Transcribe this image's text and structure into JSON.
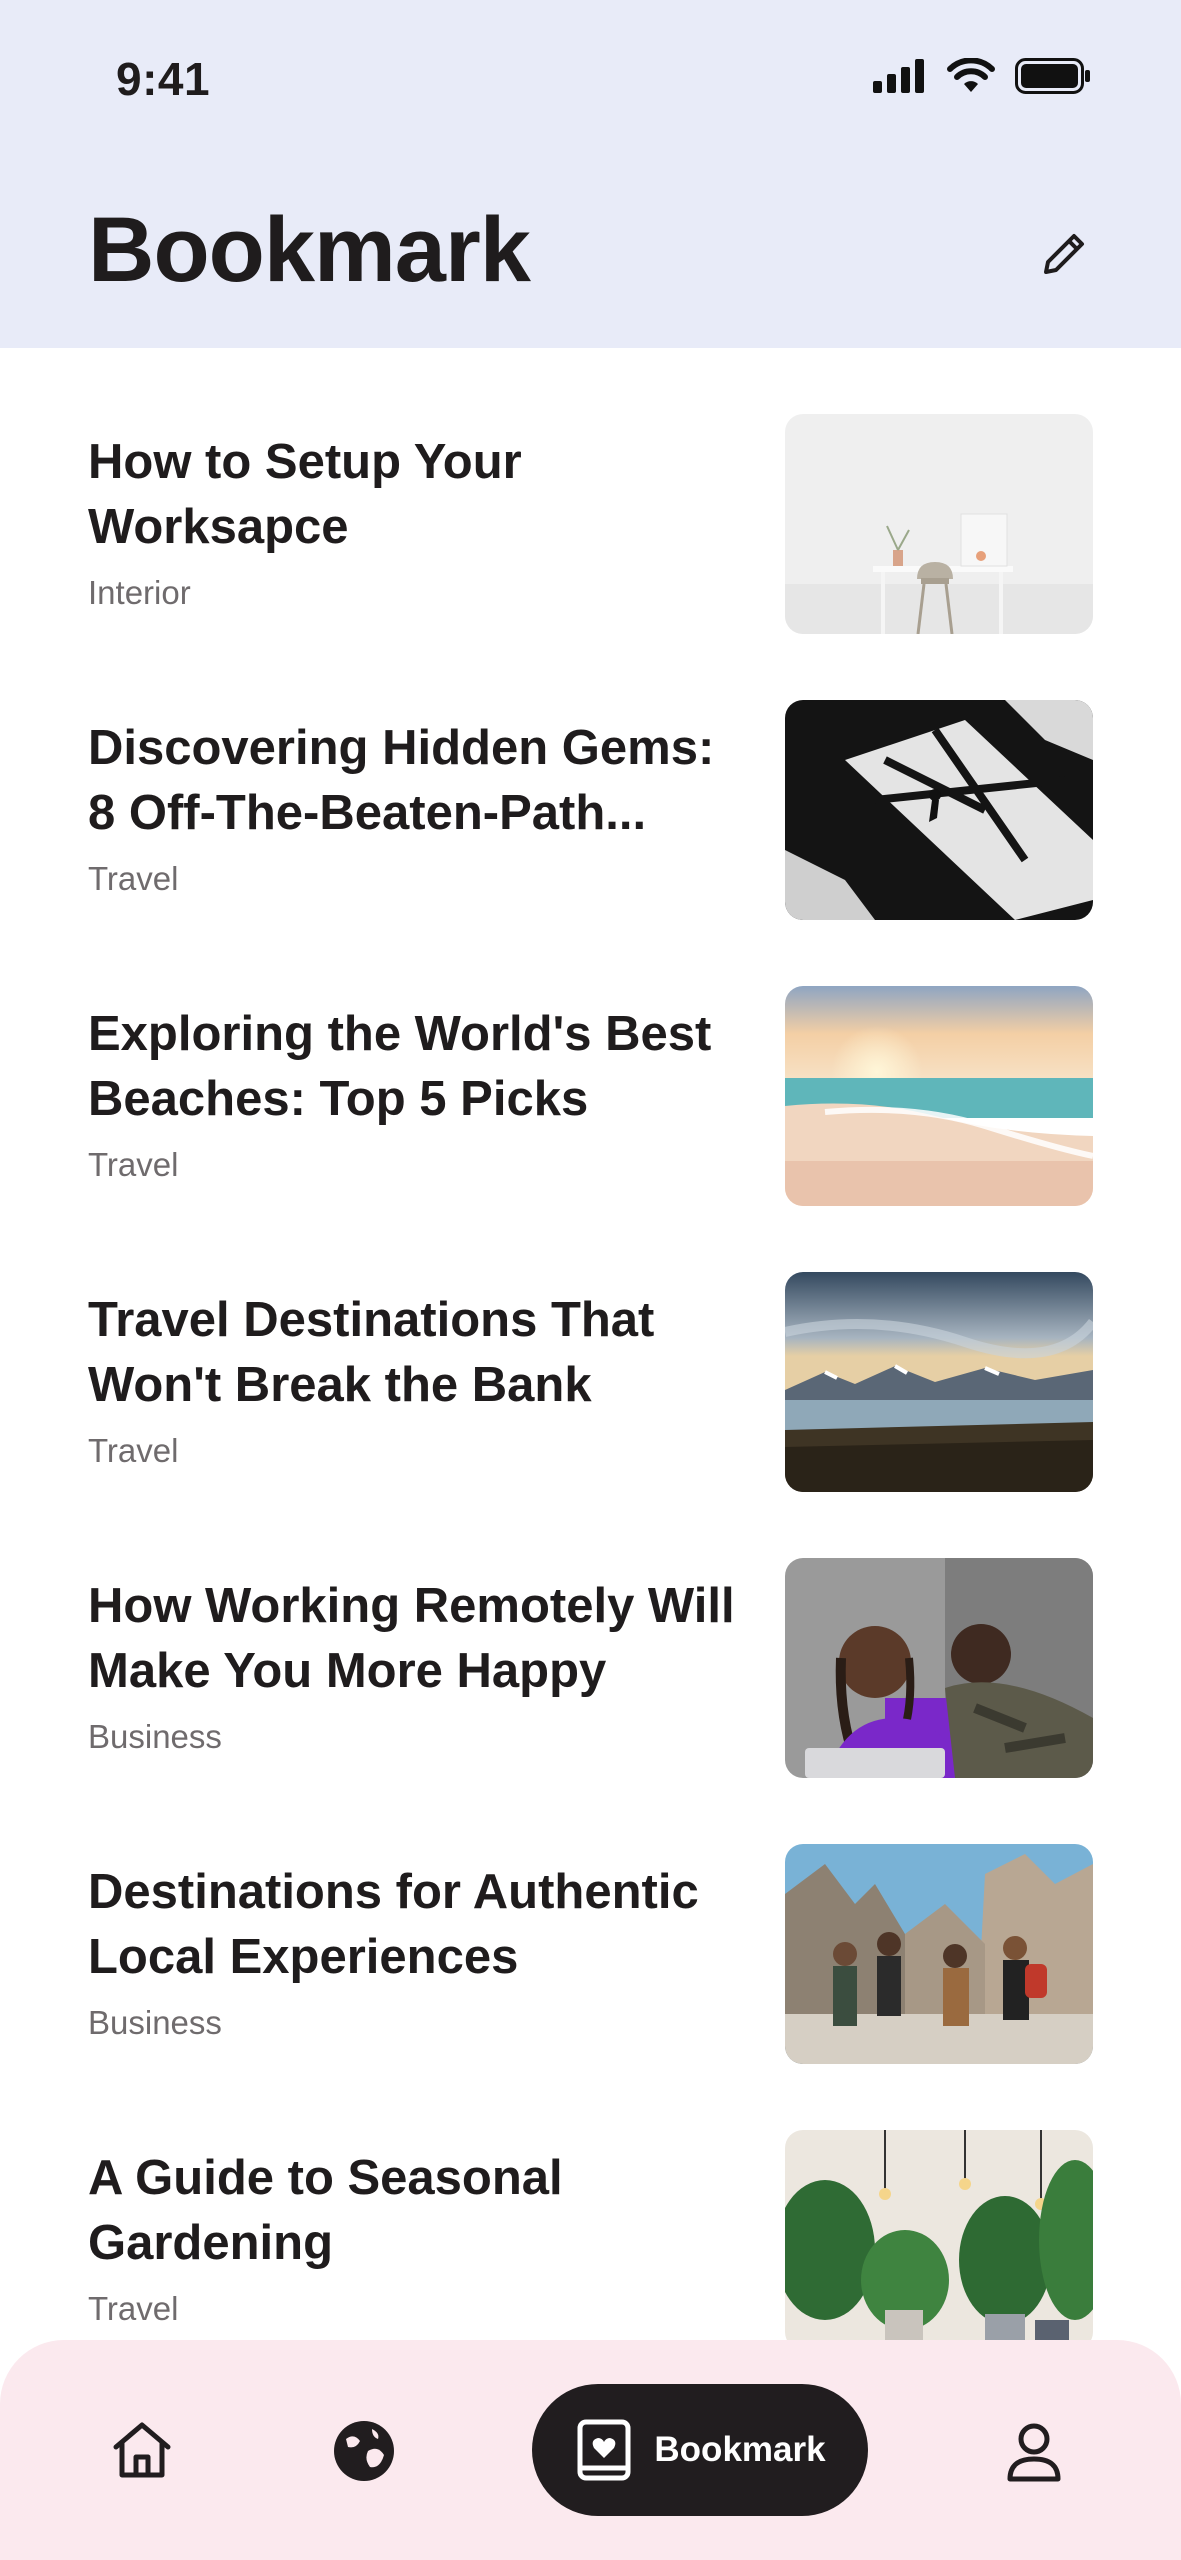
{
  "status_bar": {
    "time": "9:41"
  },
  "header": {
    "title": "Bookmark"
  },
  "articles": [
    {
      "title": "How to Setup Your Worksapce",
      "category": "Interior"
    },
    {
      "title": "Discovering Hidden Gems: 8 Off-The-Beaten-Path...",
      "category": "Travel"
    },
    {
      "title": "Exploring the World's Best Beaches: Top 5 Picks",
      "category": "Travel"
    },
    {
      "title": "Travel Destinations That Won't Break the Bank",
      "category": "Travel"
    },
    {
      "title": "How Working Remotely Will Make You More Happy",
      "category": "Business"
    },
    {
      "title": "Destinations for Authentic Local Experiences",
      "category": "Business"
    },
    {
      "title": "A Guide to Seasonal Gardening",
      "category": "Travel"
    }
  ],
  "bottom_nav": {
    "items": [
      "home-icon",
      "globe-icon",
      "bookmark-icon",
      "profile-icon"
    ],
    "active_label": "Bookmark"
  },
  "colors": {
    "header_bg": "#e8ebf8",
    "nav_bg": "#fbe9ee",
    "active_pill": "#211d1f"
  }
}
